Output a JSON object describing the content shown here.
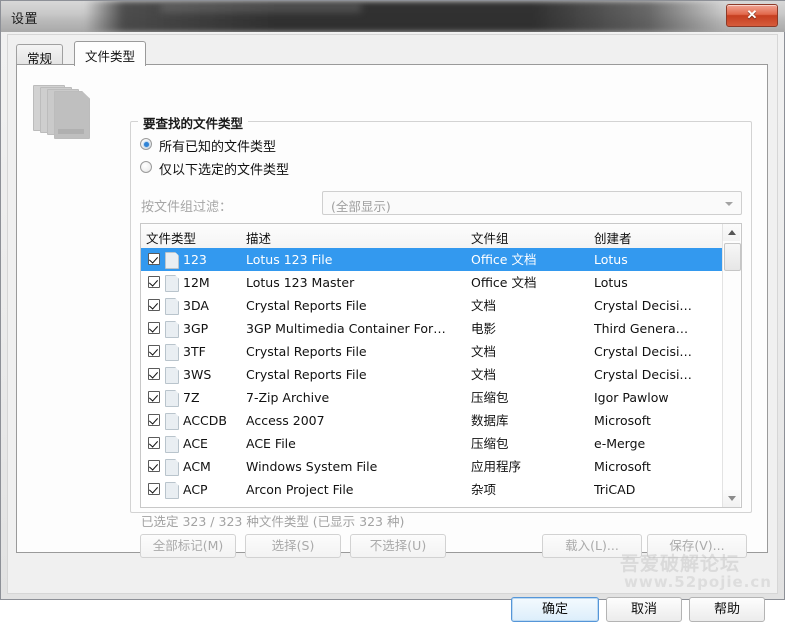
{
  "window": {
    "title": "设置",
    "close_label": "✕"
  },
  "tabs": [
    {
      "label": "常规",
      "active": false
    },
    {
      "label": "文件类型",
      "active": true
    }
  ],
  "groupbox": {
    "title": "要查找的文件类型",
    "radios": [
      {
        "label": "所有已知的文件类型",
        "checked": true
      },
      {
        "label": "仅以下选定的文件类型",
        "checked": false
      }
    ],
    "filter": {
      "label": "按文件组过滤：",
      "value": "(全部显示)",
      "enabled": false
    }
  },
  "table": {
    "columns": [
      "文件类型",
      "描述",
      "文件组",
      "创建者"
    ],
    "rows": [
      {
        "checked": true,
        "type": "123",
        "desc": "Lotus 123 File",
        "group": "Office 文档",
        "creator": "Lotus",
        "selected": true
      },
      {
        "checked": true,
        "type": "12M",
        "desc": "Lotus 123 Master",
        "group": "Office 文档",
        "creator": "Lotus",
        "selected": false
      },
      {
        "checked": true,
        "type": "3DA",
        "desc": "Crystal Reports File",
        "group": "文档",
        "creator": "Crystal Decisi…",
        "selected": false
      },
      {
        "checked": true,
        "type": "3GP",
        "desc": "3GP Multimedia Container For…",
        "group": "电影",
        "creator": "Third Genera…",
        "selected": false
      },
      {
        "checked": true,
        "type": "3TF",
        "desc": "Crystal Reports File",
        "group": "文档",
        "creator": "Crystal Decisi…",
        "selected": false
      },
      {
        "checked": true,
        "type": "3WS",
        "desc": "Crystal Reports File",
        "group": "文档",
        "creator": "Crystal Decisi…",
        "selected": false
      },
      {
        "checked": true,
        "type": "7Z",
        "desc": "7-Zip Archive",
        "group": "压缩包",
        "creator": "Igor Pawlow",
        "selected": false
      },
      {
        "checked": true,
        "type": "ACCDB",
        "desc": "Access 2007",
        "group": "数据库",
        "creator": "Microsoft",
        "selected": false
      },
      {
        "checked": true,
        "type": "ACE",
        "desc": "ACE File",
        "group": "压缩包",
        "creator": "e-Merge",
        "selected": false
      },
      {
        "checked": true,
        "type": "ACM",
        "desc": "Windows System File",
        "group": "应用程序",
        "creator": "Microsoft",
        "selected": false
      },
      {
        "checked": true,
        "type": "ACP",
        "desc": "Arcon Project File",
        "group": "杂项",
        "creator": "TriCAD",
        "selected": false
      }
    ]
  },
  "status": "已选定 323 / 323 种文件类型 (已显示 323 种)",
  "list_buttons": [
    {
      "label": "全部标记(M)",
      "enabled": false
    },
    {
      "label": "选择(S)",
      "enabled": false
    },
    {
      "label": "不选择(U)",
      "enabled": false
    },
    {
      "label": "载入(L)...",
      "enabled": false
    },
    {
      "label": "保存(V)...",
      "enabled": false
    }
  ],
  "dialog_buttons": [
    {
      "label": "确定",
      "default": true
    },
    {
      "label": "取消",
      "default": false
    },
    {
      "label": "帮助",
      "default": false
    }
  ],
  "watermark": {
    "line1": "吾爱破解论坛",
    "line2": "www.52pojie.cn"
  },
  "colors": {
    "selection": "#3399ef",
    "close_button": "#c63e20",
    "radio_dot": "#2f83d6",
    "default_button_border": "#5596d8"
  }
}
